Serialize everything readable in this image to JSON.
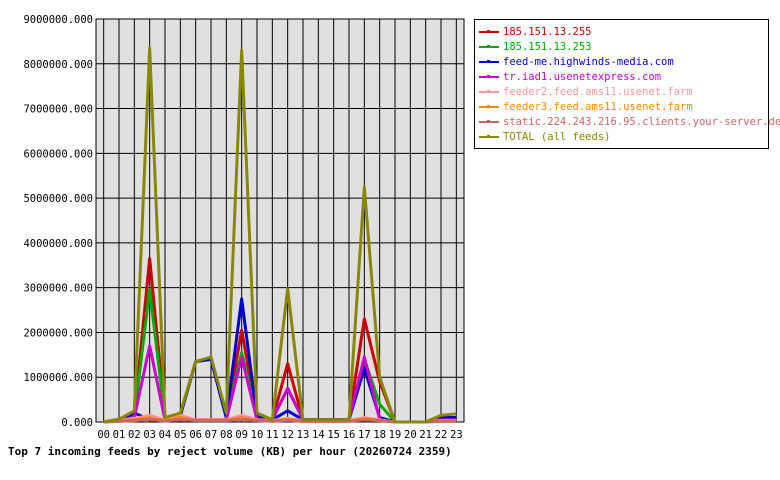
{
  "chart_data": {
    "type": "line",
    "title": "Top 7 incoming feeds by reject volume (KB) per hour (20260724 2359)",
    "xlabel": "",
    "ylabel": "",
    "ylim": [
      0,
      9000000
    ],
    "y_ticks": [
      "0.000",
      "1000000.000",
      "2000000.000",
      "3000000.000",
      "4000000.000",
      "5000000.000",
      "6000000.000",
      "7000000.000",
      "8000000.000",
      "9000000.000"
    ],
    "categories": [
      "00",
      "01",
      "02",
      "03",
      "04",
      "05",
      "06",
      "07",
      "08",
      "09",
      "10",
      "11",
      "12",
      "13",
      "14",
      "15",
      "16",
      "17",
      "18",
      "19",
      "20",
      "21",
      "22",
      "23"
    ],
    "grid": true,
    "legend_position": "right",
    "series": [
      {
        "name": "185.151.13.255",
        "color": "#cc0000",
        "values": [
          0,
          60000,
          150000,
          3650000,
          100000,
          150000,
          1350000,
          1400000,
          100000,
          2050000,
          150000,
          50000,
          1300000,
          50000,
          50000,
          50000,
          50000,
          2300000,
          900000,
          0,
          0,
          0,
          100000,
          100000
        ]
      },
      {
        "name": "185.151.13.253",
        "color": "#00aa00",
        "values": [
          0,
          60000,
          150000,
          2950000,
          100000,
          150000,
          1350000,
          1400000,
          100000,
          1550000,
          150000,
          50000,
          750000,
          50000,
          50000,
          50000,
          50000,
          1400000,
          400000,
          0,
          0,
          0,
          100000,
          100000
        ]
      },
      {
        "name": "feed-me.highwinds-media.com",
        "color": "#0000cc",
        "values": [
          0,
          50000,
          200000,
          50000,
          50000,
          150000,
          1350000,
          1400000,
          100000,
          2750000,
          100000,
          50000,
          250000,
          50000,
          50000,
          50000,
          50000,
          1200000,
          100000,
          0,
          0,
          0,
          100000,
          100000
        ]
      },
      {
        "name": "tr.iad1.usenetexpress.com",
        "color": "#cc00cc",
        "values": [
          0,
          40000,
          100000,
          1700000,
          50000,
          50000,
          50000,
          50000,
          50000,
          1450000,
          50000,
          50000,
          750000,
          50000,
          50000,
          50000,
          50000,
          1450000,
          50000,
          0,
          0,
          0,
          50000,
          50000
        ]
      },
      {
        "name": "feeder2.feed.ams11.usenet.farm",
        "color": "#ff9999",
        "values": [
          0,
          30000,
          80000,
          150000,
          40000,
          150000,
          50000,
          50000,
          50000,
          150000,
          50000,
          30000,
          80000,
          30000,
          30000,
          30000,
          30000,
          100000,
          50000,
          0,
          0,
          0,
          30000,
          30000
        ]
      },
      {
        "name": "feeder3.feed.ams11.usenet.farm",
        "color": "#ff8800",
        "values": [
          0,
          20000,
          50000,
          100000,
          30000,
          100000,
          40000,
          40000,
          40000,
          100000,
          40000,
          20000,
          60000,
          20000,
          20000,
          20000,
          20000,
          80000,
          40000,
          0,
          0,
          0,
          20000,
          20000
        ]
      },
      {
        "name": "static.224.243.216.95.clients.your-server.de",
        "color": "#cc6666",
        "values": [
          0,
          15000,
          30000,
          60000,
          20000,
          60000,
          30000,
          30000,
          30000,
          60000,
          30000,
          15000,
          40000,
          15000,
          15000,
          15000,
          15000,
          50000,
          30000,
          0,
          0,
          0,
          15000,
          15000
        ]
      },
      {
        "name": "TOTAL (all feeds)",
        "color": "#888800",
        "values": [
          0,
          60000,
          250000,
          8350000,
          100000,
          200000,
          1350000,
          1450000,
          200000,
          8300000,
          200000,
          50000,
          2980000,
          50000,
          50000,
          50000,
          50000,
          5250000,
          1000000,
          0,
          0,
          0,
          150000,
          180000
        ]
      }
    ]
  }
}
